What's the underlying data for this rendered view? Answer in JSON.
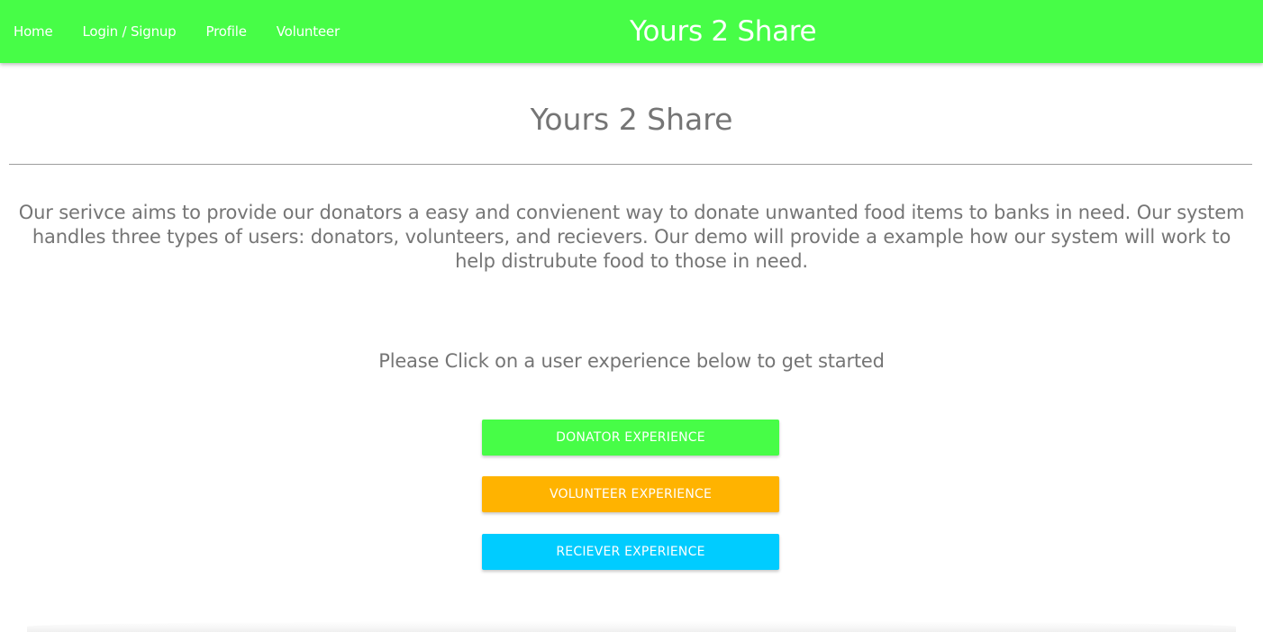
{
  "navbar": {
    "links": [
      {
        "label": "Home"
      },
      {
        "label": "Login / Signup"
      },
      {
        "label": "Profile"
      },
      {
        "label": "Volunteer"
      }
    ],
    "brand": "Yours 2 Share",
    "background_color": "#47fd47"
  },
  "main": {
    "title": "Yours 2 Share",
    "description": "Our serivce aims to provide our donators a easy and convienent way to donate unwanted food items to banks in need. Our system handles three types of users: donators, volunteers, and recievers. Our demo will provide a example how our system will work to help distrubute food to those in need.",
    "prompt": "Please Click on a user experience below to get started",
    "buttons": [
      {
        "label": "DONATOR EXPERIENCE",
        "color": "#47fd47"
      },
      {
        "label": "VOLUNTEER EXPERIENCE",
        "color": "#ffb300"
      },
      {
        "label": "RECIEVER EXPERIENCE",
        "color": "#00ccff"
      }
    ]
  }
}
